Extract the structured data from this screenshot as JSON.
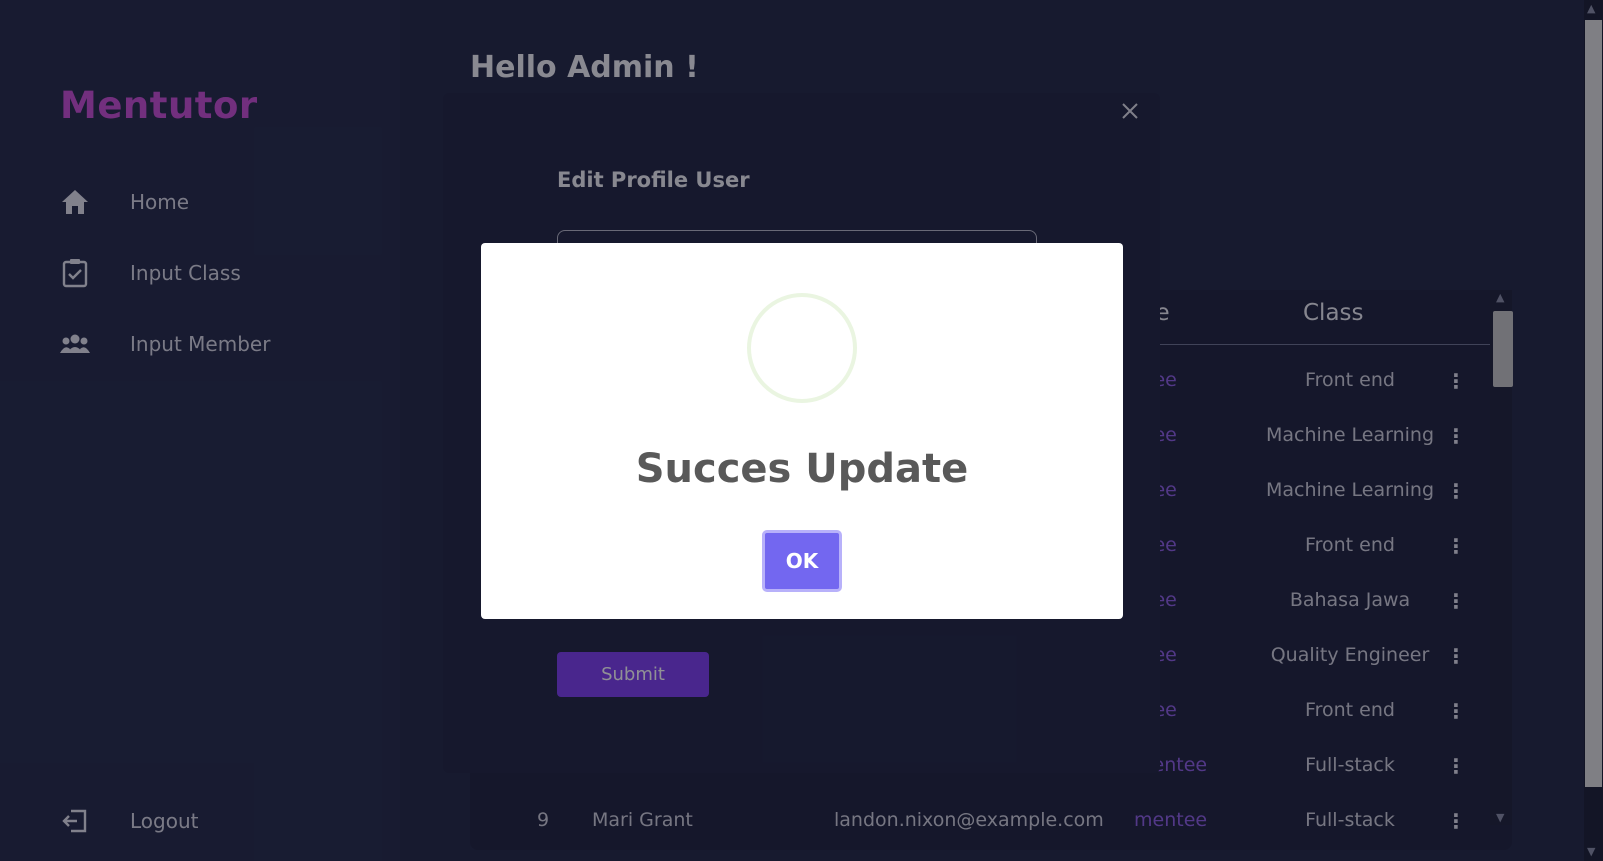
{
  "sidebar": {
    "logo": "Mentutor",
    "items": [
      {
        "label": "Home",
        "icon": "home-icon"
      },
      {
        "label": "Input Class",
        "icon": "clipboard-check-icon"
      },
      {
        "label": "Input Member",
        "icon": "users-icon"
      }
    ],
    "logout": {
      "label": "Logout",
      "icon": "logout-icon"
    }
  },
  "main": {
    "greeting": "Hello Admin !",
    "table": {
      "headers": {
        "role": "ole",
        "class": "Class"
      },
      "rows": [
        {
          "no": "",
          "name": "",
          "email": "",
          "role": "ntee",
          "class": "Front end"
        },
        {
          "no": "",
          "name": "",
          "email": "",
          "role": "ntee",
          "class": "Machine Learning"
        },
        {
          "no": "",
          "name": "",
          "email": "",
          "role": "ntee",
          "class": "Machine Learning"
        },
        {
          "no": "",
          "name": "",
          "email": "",
          "role": "ntee",
          "class": "Front end"
        },
        {
          "no": "",
          "name": "",
          "email": "",
          "role": "ntee",
          "class": "Bahasa Jawa"
        },
        {
          "no": "",
          "name": "",
          "email": "",
          "role": "ntee",
          "class": "Quality Engineer"
        },
        {
          "no": "",
          "name": "",
          "email": "",
          "role": "ntee",
          "class": "Front end"
        },
        {
          "no": "",
          "name": "",
          "email": "",
          "role": "mentee",
          "class": "Full-stack"
        },
        {
          "no": "9",
          "name": "Mari Grant",
          "email": "landon.nixon@example.com",
          "role": "mentee",
          "class": "Full-stack"
        }
      ]
    }
  },
  "edit_modal": {
    "title": "Edit Profile User",
    "submit_label": "Submit"
  },
  "success_dialog": {
    "title": "Succes Update",
    "ok_label": "OK"
  },
  "colors": {
    "accent": "#7367f0",
    "brand": "#c94fd6",
    "submit": "#7f3ff0",
    "role": "#8e5fe6"
  }
}
